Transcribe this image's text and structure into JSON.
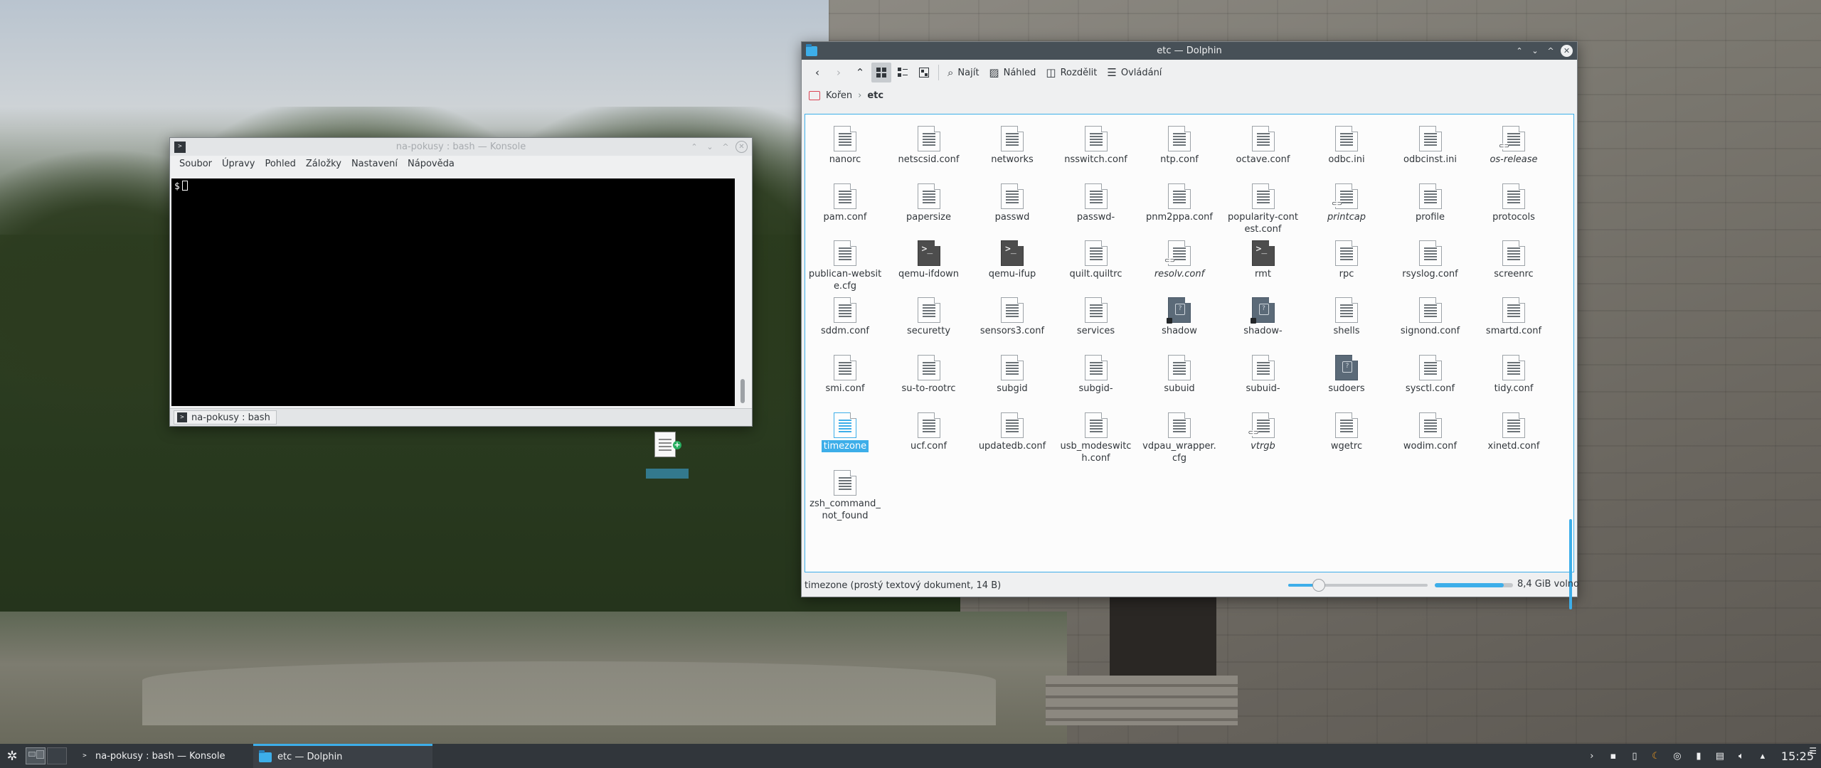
{
  "konsole": {
    "title": "na-pokusy : bash — Konsole",
    "menu": [
      "Soubor",
      "Úpravy",
      "Pohled",
      "Záložky",
      "Nastavení",
      "Nápověda"
    ],
    "prompt": "$",
    "tab_label": "na-pokusy : bash",
    "drag_item_icon": "text-file-icon"
  },
  "dolphin": {
    "title": "etc — Dolphin",
    "toolbar": {
      "find": "Najít",
      "preview": "Náhled",
      "split": "Rozdělit",
      "control": "Ovládání"
    },
    "breadcrumb": {
      "root": "Kořen",
      "current": "etc"
    },
    "files": [
      {
        "name": "nanorc",
        "icon": "text"
      },
      {
        "name": "netscsid.conf",
        "icon": "text"
      },
      {
        "name": "networks",
        "icon": "text"
      },
      {
        "name": "nsswitch.conf",
        "icon": "text"
      },
      {
        "name": "ntp.conf",
        "icon": "text"
      },
      {
        "name": "octave.conf",
        "icon": "text"
      },
      {
        "name": "odbc.ini",
        "icon": "text"
      },
      {
        "name": "odbcinst.ini",
        "icon": "text"
      },
      {
        "name": "os-release",
        "icon": "link"
      },
      {
        "name": "pam.conf",
        "icon": "text"
      },
      {
        "name": "papersize",
        "icon": "text"
      },
      {
        "name": "passwd",
        "icon": "text"
      },
      {
        "name": "passwd-",
        "icon": "text"
      },
      {
        "name": "pnm2ppa.conf",
        "icon": "text"
      },
      {
        "name": "popularity-contest.conf",
        "icon": "text"
      },
      {
        "name": "printcap",
        "icon": "link"
      },
      {
        "name": "profile",
        "icon": "text"
      },
      {
        "name": "protocols",
        "icon": "text"
      },
      {
        "name": "publican-website.cfg",
        "icon": "text"
      },
      {
        "name": "qemu-ifdown",
        "icon": "exec"
      },
      {
        "name": "qemu-ifup",
        "icon": "exec"
      },
      {
        "name": "quilt.quiltrc",
        "icon": "text"
      },
      {
        "name": "resolv.conf",
        "icon": "link"
      },
      {
        "name": "rmt",
        "icon": "exec"
      },
      {
        "name": "rpc",
        "icon": "text"
      },
      {
        "name": "rsyslog.conf",
        "icon": "text"
      },
      {
        "name": "screenrc",
        "icon": "text"
      },
      {
        "name": "sddm.conf",
        "icon": "text"
      },
      {
        "name": "securetty",
        "icon": "text"
      },
      {
        "name": "sensors3.conf",
        "icon": "text"
      },
      {
        "name": "services",
        "icon": "text"
      },
      {
        "name": "shadow",
        "icon": "locked"
      },
      {
        "name": "shadow-",
        "icon": "locked"
      },
      {
        "name": "shells",
        "icon": "text"
      },
      {
        "name": "signond.conf",
        "icon": "text"
      },
      {
        "name": "smartd.conf",
        "icon": "text"
      },
      {
        "name": "smi.conf",
        "icon": "text"
      },
      {
        "name": "su-to-rootrc",
        "icon": "text"
      },
      {
        "name": "subgid",
        "icon": "text"
      },
      {
        "name": "subgid-",
        "icon": "text"
      },
      {
        "name": "subuid",
        "icon": "text"
      },
      {
        "name": "subuid-",
        "icon": "text"
      },
      {
        "name": "sudoers",
        "icon": "locked-noshadow"
      },
      {
        "name": "sysctl.conf",
        "icon": "text"
      },
      {
        "name": "tidy.conf",
        "icon": "text"
      },
      {
        "name": "timezone",
        "icon": "selected"
      },
      {
        "name": "ucf.conf",
        "icon": "text"
      },
      {
        "name": "updatedb.conf",
        "icon": "text"
      },
      {
        "name": "usb_modeswitch.conf",
        "icon": "text"
      },
      {
        "name": "vdpau_wrapper.cfg",
        "icon": "text"
      },
      {
        "name": "vtrgb",
        "icon": "link"
      },
      {
        "name": "wgetrc",
        "icon": "text"
      },
      {
        "name": "wodim.conf",
        "icon": "text"
      },
      {
        "name": "xinetd.conf",
        "icon": "text"
      },
      {
        "name": "zsh_command_not_found",
        "icon": "text"
      }
    ],
    "status_text": "timezone (prostý textový dokument, 14 B)",
    "free_space": "8,4 GiB volno",
    "zoom_level": 0.22,
    "used_space_fraction": 0.88
  },
  "taskbar": {
    "tasks": [
      {
        "label": "na-pokusy : bash — Konsole",
        "icon": "terminal-icon"
      },
      {
        "label": "etc — Dolphin",
        "icon": "folder-icon"
      }
    ],
    "clock": "15:25"
  },
  "colors": {
    "accent": "#3daee9",
    "dolphin_titlebar": "#475057",
    "taskbar": "#31363b"
  }
}
